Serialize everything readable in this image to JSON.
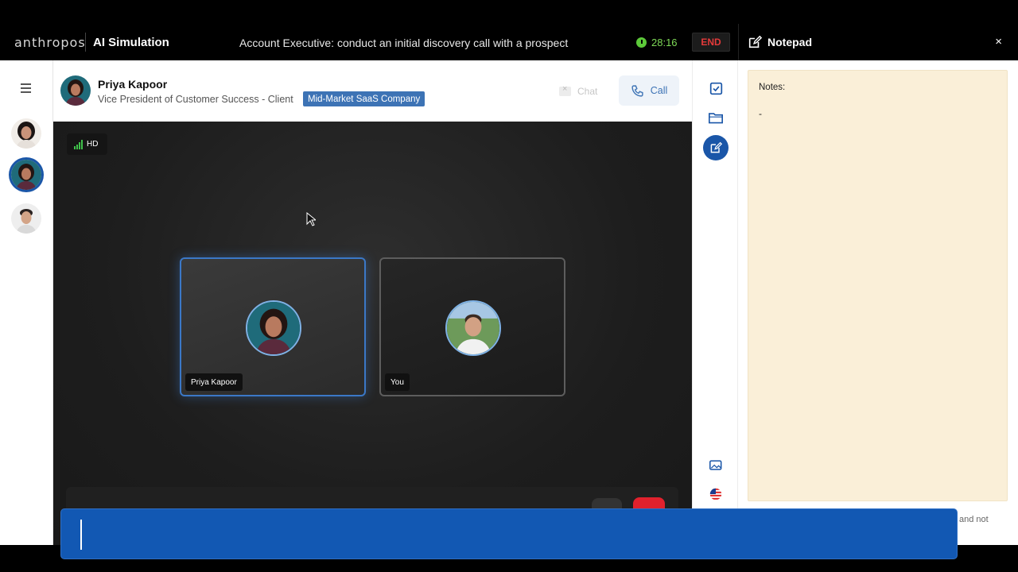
{
  "topbar": {
    "brand": "anthropos",
    "app_title": "AI Simulation",
    "task": "Account Executive: conduct an initial discovery call with a prospect",
    "timer": "28:16",
    "end_label": "END"
  },
  "notepad_header": {
    "title": "Notepad",
    "close": "×"
  },
  "header": {
    "name": "Priya Kapoor",
    "role": "Vice President of Customer Success - Client",
    "badge": "Mid-Market SaaS Company",
    "chat_label": "Chat",
    "call_label": "Call"
  },
  "stage": {
    "quality": "HD",
    "tiles": [
      {
        "label": "Priya Kapoor"
      },
      {
        "label": "You"
      }
    ]
  },
  "notepad": {
    "label": "Notes:",
    "content": "-",
    "tail_text": "and not"
  },
  "colors": {
    "accent": "#1a56a8",
    "timer_green": "#5cc939",
    "end_red": "#e43a3a",
    "notepad_bg": "#faefd8",
    "input_bar": "#1258b3"
  }
}
